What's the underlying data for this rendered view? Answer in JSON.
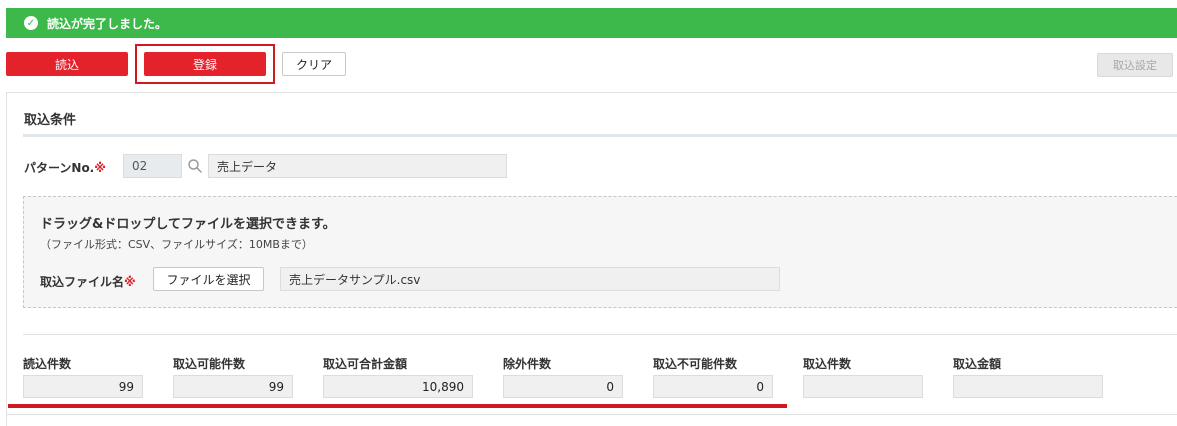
{
  "alert": {
    "icon": "check-circle-icon",
    "message": "読込が完了しました。",
    "color": "#3cb94a"
  },
  "toolbar": {
    "read_label": "読込",
    "register_label": "登録",
    "clear_label": "クリア",
    "settings_label": "取込設定",
    "accent": "#e3222c"
  },
  "conditions": {
    "title": "取込条件",
    "pattern": {
      "label": "パターンNo.",
      "required_mark": "※",
      "code": "02",
      "name": "売上データ",
      "icon": "search-icon"
    },
    "dropzone": {
      "title": "ドラッグ&ドロップしてファイルを選択できます。",
      "note": "（ファイル形式：CSV、ファイルサイズ：10MBまで）"
    },
    "file": {
      "label": "取込ファイル名",
      "required_mark": "※",
      "button_label": "ファイルを選択",
      "filename": "売上データサンプル.csv"
    }
  },
  "stats": [
    {
      "label": "読込件数",
      "value": "99"
    },
    {
      "label": "取込可能件数",
      "value": "99"
    },
    {
      "label": "取込可合計金額",
      "value": "10,890"
    },
    {
      "label": "除外件数",
      "value": "0"
    },
    {
      "label": "取込不可能件数",
      "value": "0"
    },
    {
      "label": "取込件数",
      "value": ""
    },
    {
      "label": "取込金額",
      "value": ""
    }
  ]
}
